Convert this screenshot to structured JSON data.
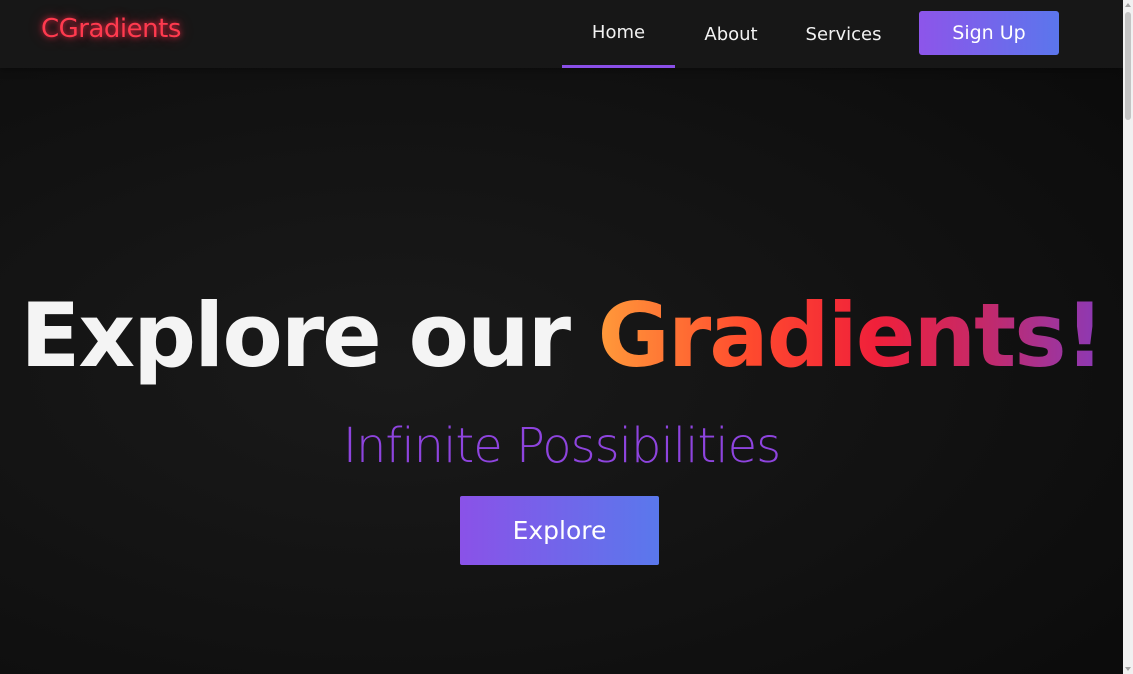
{
  "navbar": {
    "logo": "CGradients",
    "items": [
      {
        "label": "Home",
        "active": true
      },
      {
        "label": "About",
        "active": false
      },
      {
        "label": "Services",
        "active": false
      }
    ],
    "signup_label": "Sign Up"
  },
  "hero": {
    "title_plain": "Explore our ",
    "title_gradient": "Gradients!",
    "subtitle": "Infinite Possibilities",
    "cta_label": "Explore"
  },
  "colors": {
    "background": "#0c0c0c",
    "navbar": "#171717",
    "logo": "#ff3a4e",
    "accent_purple": "#8a4fe8",
    "button_gradient_start": "#8d55ea",
    "button_gradient_end": "#5b76ec",
    "subtitle": "#8e44de"
  }
}
